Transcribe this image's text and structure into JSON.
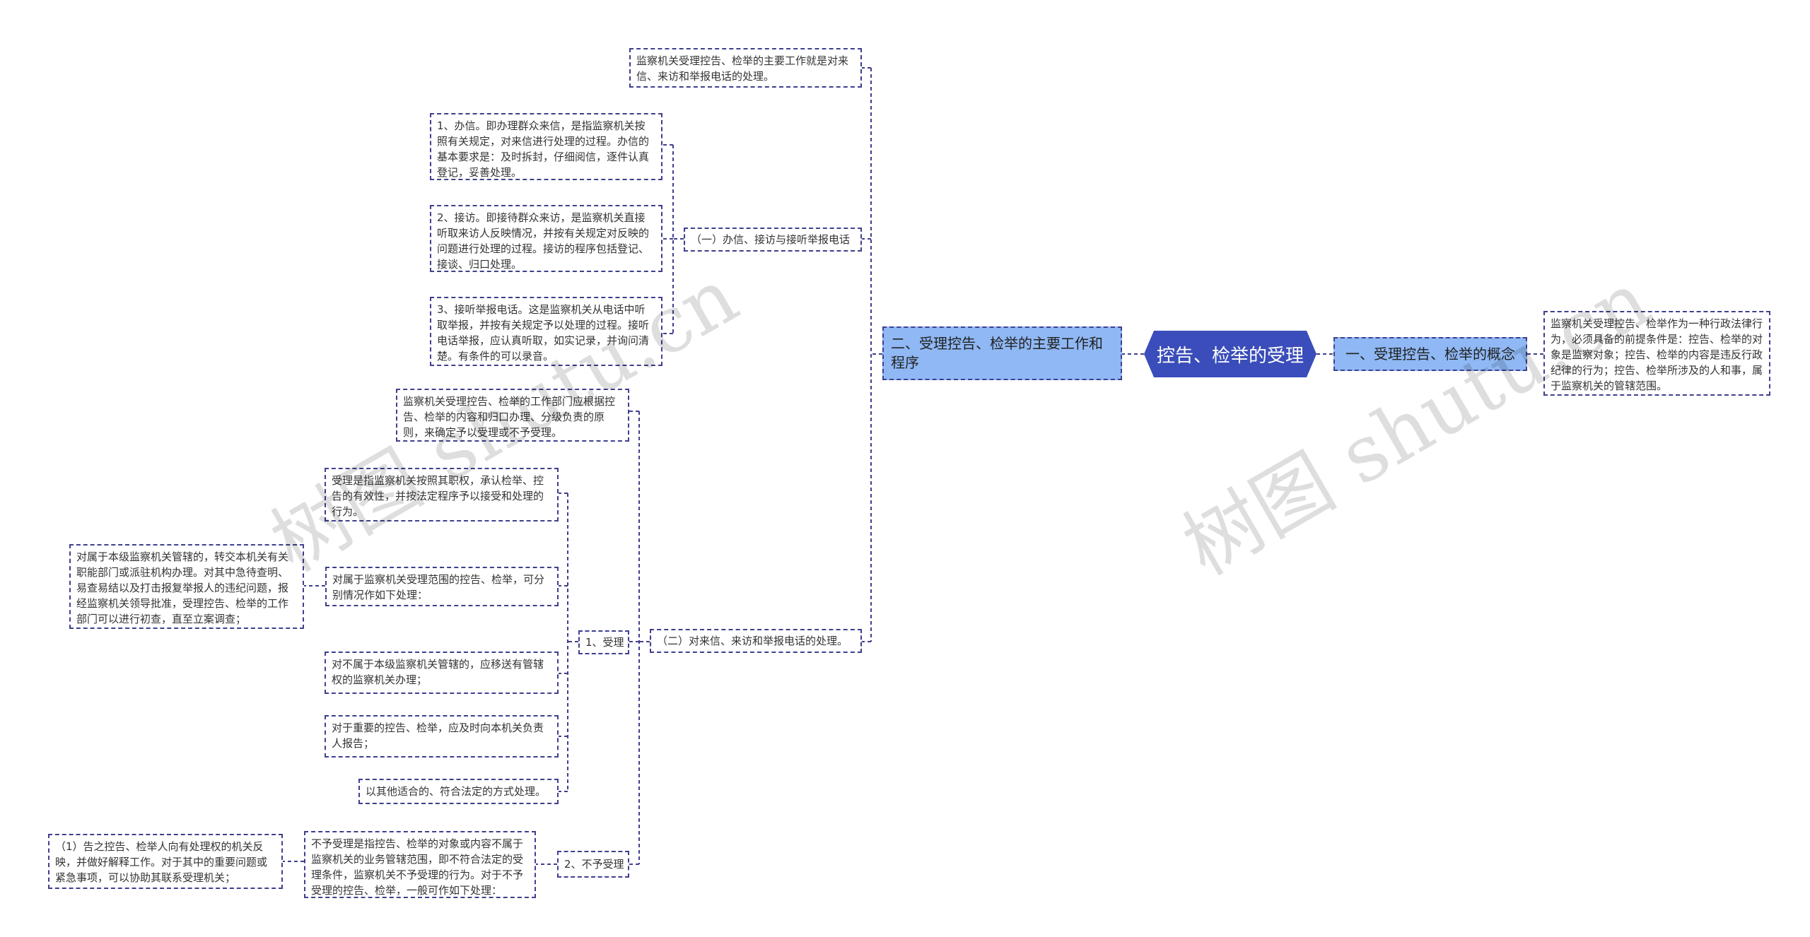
{
  "root": {
    "title": "控告、检举的受理"
  },
  "nodes": {
    "concept_heading": "一、受理控告、检举的概念",
    "concept_body": "监察机关受理控告、检举作为一种行政法律行为，必须具备的前提条件是：控告、检举的对象是监察对象；控告、检举的内容是违反行政纪律的行为；控告、检举所涉及的人和事，属于监察机关的管辖范围。",
    "main_heading": "二、受理控告、检举的主要工作和程序",
    "main_intro": "监察机关受理控告、检举的主要工作就是对来信、来访和举报电话的处理。",
    "part1_heading": "（一）办信、接访与接听举报电话",
    "part1_letters": "1、办信。即办理群众来信，是指监察机关按照有关规定，对来信进行处理的过程。办信的基本要求是：及时拆封，仔细阅信，逐件认真登记，妥善处理。",
    "part1_visits": "2、接访。即接待群众来访，是监察机关直接听取来访人反映情况，并按有关规定对反映的问题进行处理的过程。接访的程序包括登记、接谈、归口处理。",
    "part1_phone": "3、接听举报电话。这是监察机关从电话中听取举报，并按有关规定予以处理的过程。接听电话举报，应认真听取，如实记录，并询问清楚。有条件的可以录音。",
    "part2_heading": "（二）对来信、来访和举报电话的处理。",
    "part2_intro": "监察机关受理控告、检举的工作部门应根据控告、检举的内容和归口办理、分级负责的原则，来确定予以受理或不予受理。",
    "accept_heading": "1、受理",
    "accept_def": "受理是指监察机关按照其职权，承认检举、控告的有效性，并按法定程序予以接受和处理的行为。",
    "accept_cases": "对属于监察机关受理范围的控告、检举，可分别情况作如下处理：",
    "accept_cases_detail": "对属于本级监察机关管辖的，转交本机关有关职能部门或派驻机构办理。对其中急待查明、易查易结以及打击报复举报人的违纪问题，报经监察机关领导批准，受理控告、检举的工作部门可以进行初查，直至立案调查；",
    "accept_other_level": "对不属于本级监察机关管辖的，应移送有管辖权的监察机关办理；",
    "accept_important": "对于重要的控告、检举，应及时向本机关负责人报告；",
    "accept_other_way": "以其他适合的、符合法定的方式处理。",
    "reject_heading": "2、不予受理",
    "reject_def": "不予受理是指控告、检举的对象或内容不属于监察机关的业务管辖范围，即不符合法定的受理条件，监察机关不予受理的行为。对于不予受理的控告、检举，一般可作如下处理：",
    "reject_detail": "（1）告之控告、检举人向有处理权的机关反映，并做好解释工作。对于其中的重要问题或紧急事项，可以协助其联系受理机关；"
  },
  "watermarks": [
    "树图 shutu.cn",
    "树图 shutu.cn"
  ],
  "colors": {
    "line": "#3f3f8f",
    "root_fill": "#3a4dba",
    "level1_fill": "#8fb8f4",
    "node_border": "#3f3f8f"
  }
}
